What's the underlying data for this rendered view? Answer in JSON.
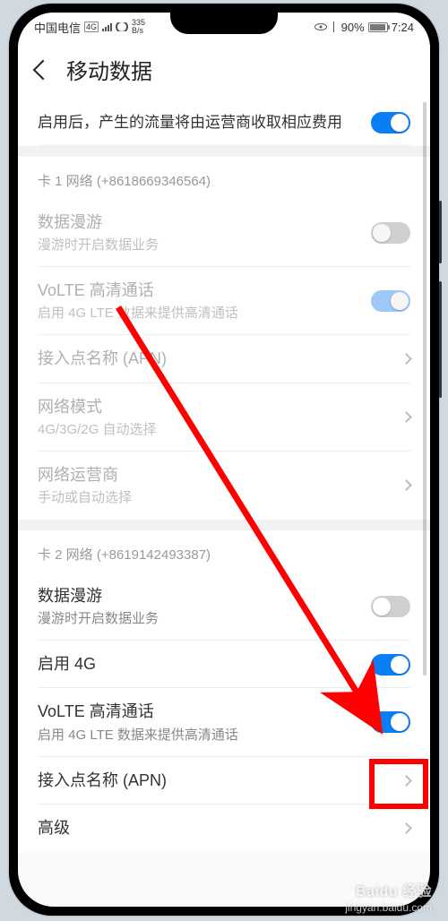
{
  "status": {
    "carrier": "中国电信",
    "net_badge": "4G",
    "speed_top": "335",
    "speed_bottom": "B/s",
    "battery_pct": "90%",
    "time": "7:24"
  },
  "header": {
    "title": "移动数据"
  },
  "intro": {
    "text": "启用后，产生的流量将由运营商收取相应费用"
  },
  "sim1": {
    "section": "卡 1 网络 (+8618669346564)",
    "roaming_title": "数据漫游",
    "roaming_sub": "漫游时开启数据业务",
    "volte_title": "VoLTE 高清通话",
    "volte_sub": "启用 4G LTE 数据来提供高清通话",
    "apn_title": "接入点名称 (APN)",
    "netmode_title": "网络模式",
    "netmode_sub": "4G/3G/2G 自动选择",
    "operator_title": "网络运营商",
    "operator_sub": "手动或自动选择"
  },
  "sim2": {
    "section": "卡 2 网络 (+8619142493387)",
    "roaming_title": "数据漫游",
    "roaming_sub": "漫游时开启数据业务",
    "enable4g_title": "启用 4G",
    "volte_title": "VoLTE 高清通话",
    "volte_sub": "启用 4G LTE 数据来提供高清通话",
    "apn_title": "接入点名称 (APN)"
  },
  "advanced": {
    "title": "高级"
  },
  "watermark": {
    "brand": "Baidu 经验",
    "url": "jingyan.baidu.com"
  }
}
